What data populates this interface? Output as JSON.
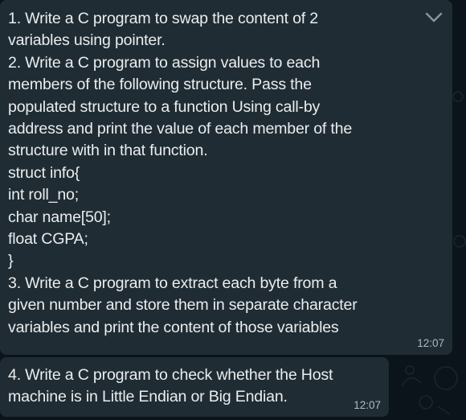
{
  "messages": [
    {
      "text": "1. Write a C program to swap the content of 2\nvariables using pointer.\n2. Write a C program to assign values to each\nmembers of the following structure. Pass the\npopulated structure to a function Using call-by\naddress and print the value of each member of the\nstructure with in that function.\nstruct info{\nint roll_no;\nchar name[50];\nfloat CGPA;\n}\n3. Write a C program to extract each byte from a\ngiven number and store them in separate character\nvariables and print the content of those variables",
      "time": "12:07",
      "menu_icon": "chevron-down-icon"
    },
    {
      "text": "4. Write a C program to check whether the Host\nmachine is in Little Endian or Big Endian.",
      "time": "12:07"
    }
  ],
  "colors": {
    "background": "#0b141a",
    "bubble": "#202c33",
    "text": "#e9edef",
    "meta": "#aebac1"
  }
}
